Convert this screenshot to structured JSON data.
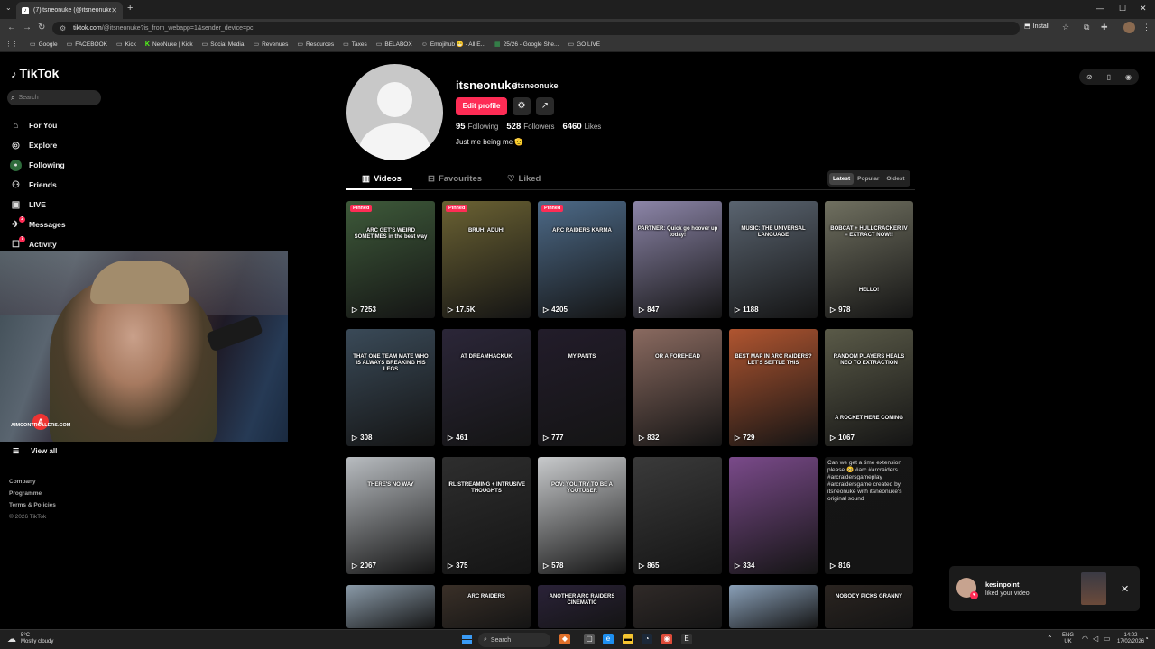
{
  "browser": {
    "tab_title": "(7)itsneonuke (@itsneonuke) | T",
    "url_host": "tiktok.com",
    "url_path": "/@itsneonuke?is_from_webapp=1&sender_device=pc",
    "install_label": "Install",
    "bookmarks": [
      {
        "label": "Google",
        "icon": "folder-icon"
      },
      {
        "label": "FACEBOOK",
        "icon": "folder-icon"
      },
      {
        "label": "Kick",
        "icon": "folder-icon"
      },
      {
        "label": "NeoNuke | Kick",
        "icon": "kick-icon"
      },
      {
        "label": "Social Media",
        "icon": "folder-icon"
      },
      {
        "label": "Revenues",
        "icon": "folder-icon"
      },
      {
        "label": "Resources",
        "icon": "folder-icon"
      },
      {
        "label": "Taxes",
        "icon": "folder-icon"
      },
      {
        "label": "BELABOX",
        "icon": "folder-icon"
      },
      {
        "label": "Emojihub 😁 - All E...",
        "icon": "emoji-icon"
      },
      {
        "label": "25/26 - Google She...",
        "icon": "sheets-icon"
      },
      {
        "label": "GO LIVE",
        "icon": "folder-icon"
      }
    ]
  },
  "sidebar": {
    "logo": "TikTok",
    "search_placeholder": "Search",
    "nav": [
      {
        "label": "For You",
        "icon": "home-icon"
      },
      {
        "label": "Explore",
        "icon": "compass-icon"
      },
      {
        "label": "Following",
        "icon": "following-avatar-icon"
      },
      {
        "label": "Friends",
        "icon": "friends-icon"
      },
      {
        "label": "LIVE",
        "icon": "live-icon"
      },
      {
        "label": "Messages",
        "icon": "messages-icon",
        "badge": "2"
      },
      {
        "label": "Activity",
        "icon": "activity-icon",
        "badge": "7"
      }
    ],
    "webcam_watermark": "AIMCONTROLLERS.COM",
    "view_all": "View all",
    "footer": [
      "Company",
      "Programme",
      "Terms & Policies"
    ],
    "copyright": "© 2026 TikTok"
  },
  "profile": {
    "username": "itsneonuke",
    "nickname": "itsneonuke",
    "edit_label": "Edit profile",
    "stats": [
      {
        "value": "95",
        "label": "Following"
      },
      {
        "value": "528",
        "label": "Followers"
      },
      {
        "value": "6460",
        "label": "Likes"
      }
    ],
    "bio": "Just me being me 🫡",
    "tabs": [
      "Videos",
      "Favourites",
      "Liked"
    ],
    "sort": [
      "Latest",
      "Popular",
      "Oldest"
    ]
  },
  "videos": [
    {
      "views": "7253",
      "pinned": "Pinned",
      "caption": "ARC GET'S WEIRD SOMETIMES in the best way",
      "bg": "#3e5a3a"
    },
    {
      "views": "17.5K",
      "pinned": "Pinned",
      "caption": "BRUH! ADUH!",
      "bg": "#6b6233"
    },
    {
      "views": "4205",
      "pinned": "Pinned",
      "caption": "ARC RAIDERS KARMA",
      "bg": "#4d6a88"
    },
    {
      "views": "847",
      "caption": "PARTNER: Quick go hoover up today!",
      "bg": "#8c85a8"
    },
    {
      "views": "1188",
      "caption": "MUSIC: THE UNIVERSAL LANGUAGE",
      "bg": "#5a6470"
    },
    {
      "views": "978",
      "caption": "BOBCAT + HULLCRACKER IV = EXTRACT NOW!!",
      "caption2": "HELLO!",
      "bg": "#707060"
    },
    {
      "views": "308",
      "caption": "THAT ONE TEAM MATE WHO IS ALWAYS BREAKING HIS LEGS",
      "bg": "#3a4a58"
    },
    {
      "views": "461",
      "caption": "AT DREAMHACKUK",
      "bg": "#2b2638"
    },
    {
      "views": "777",
      "caption": "MY PANTS",
      "bg": "#221c2a"
    },
    {
      "views": "832",
      "caption": "OR A FOREHEAD",
      "bg": "#8a6a60"
    },
    {
      "views": "729",
      "caption": "BEST MAP IN ARC RAIDERS? LET'S SETTLE THIS",
      "bg": "#b05530"
    },
    {
      "views": "1067",
      "caption": "RANDOM PLAYERS HEALS NEO TO EXTRACTION",
      "caption2": "A ROCKET HERE COMING",
      "bg": "#5a5a48"
    },
    {
      "views": "2067",
      "caption": "THERE'S NO WAY",
      "bg": "#b8bcc0"
    },
    {
      "views": "375",
      "caption": "IRL STREAMING + INTRUSIVE THOUGHTS",
      "bg": "#2e2e2e"
    },
    {
      "views": "578",
      "caption": "POV: YOU TRY TO BE A YOUTUBER",
      "bg": "#c8cacc"
    },
    {
      "views": "865",
      "caption": "",
      "bg": "#3a3a3a"
    },
    {
      "views": "334",
      "caption": "",
      "bg": "#7a4a8a"
    },
    {
      "views": "816",
      "desc": "Can we get a time extension please 🥺 #arc #arcraiders #arcraidersgameplay #arcraidersgame created by itsneonuke with itsneonuke's original sound",
      "bg": "#151515"
    },
    {
      "views": "",
      "caption": "",
      "bg": "#8a9aa8"
    },
    {
      "views": "",
      "caption": "ARC RAIDERS",
      "bg": "#3a3028"
    },
    {
      "views": "",
      "caption": "ANOTHER ARC RAIDERS CINEMATIC",
      "bg": "#2a2238"
    },
    {
      "views": "",
      "caption": "",
      "bg": "#302a28"
    },
    {
      "views": "",
      "caption": "",
      "bg": "#8aa0b8"
    },
    {
      "views": "",
      "caption": "NOBODY PICKS GRANNY",
      "bg": "#2a2420"
    }
  ],
  "toast": {
    "name": "kesinpoint",
    "message": "liked your video."
  },
  "taskbar": {
    "temp": "5°C",
    "weather": "Mostly cloudy",
    "search": "Search",
    "lang1": "ENG",
    "lang2": "UK",
    "time": "14:02",
    "date": "17/02/2026"
  }
}
